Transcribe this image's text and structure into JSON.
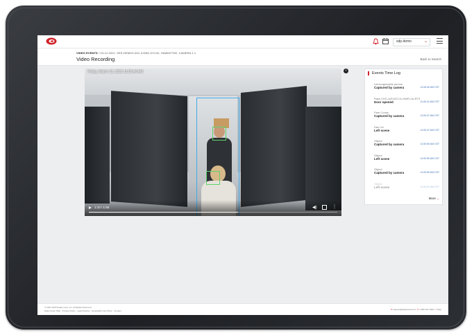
{
  "header": {
    "user": "sdp.demo",
    "icons": [
      "logo",
      "bell-icon",
      "calendar-icon",
      "chevron-down-icon",
      "menu-icon"
    ],
    "accent_color": "#d0222a"
  },
  "breadcrumb": {
    "section": "VIDEO EVENTS",
    "path": "/ 03-12-2021, SEE-DEMO2-001-3-DBG-DY120, HAWKETHE, CAMERA 1.1"
  },
  "page": {
    "title": "Video Recording",
    "back_label": "Back to Search"
  },
  "video": {
    "timestamp": "Friday, March 12, 2021 11:00:40 AM",
    "time_display": "1:10 / 1:58",
    "progress_fraction": 0.6,
    "info_glyph": "i"
  },
  "events_log": {
    "title": "Events Time Log",
    "more_label": "More",
    "items": [
      {
        "sub": "Unrecognizable person",
        "main": "Captured by camera",
        "time": "11:00:40 AM CST"
      },
      {
        "sub": "Rack CHC-A2H1DC11-HWR-1A-RT3",
        "main": "Door opened",
        "time": "11:00:41 AM CST"
      },
      {
        "sub": "Pam Cooke",
        "main": "Captured by camera",
        "time": "11:00:47 AM CST"
      },
      {
        "sub": "Dan Lei",
        "main": "Left scene",
        "time": "11:00:47 AM CST"
      },
      {
        "sub": "Object",
        "main": "Captured by camera",
        "time": "11:00:50 AM CST"
      },
      {
        "sub": "Object",
        "main": "Left scene",
        "time": "11:00:50 AM CST"
      },
      {
        "sub": "Object",
        "main": "Captured by camera",
        "time": "11:00:50 AM CST"
      },
      {
        "sub": "Object",
        "main": "Left scene",
        "time": "11:00:51 AM CST"
      }
    ]
  },
  "footer": {
    "copyright": "© 2021 SDP Reality Corp. Inc. All Rights Reserved",
    "links": "Data Center Web · Privacy Policy · Legal Notices · Acceptable Use Policy · Contact",
    "email": "support@datacentercom",
    "phone": "1-800-437-3932",
    "help": "Help"
  }
}
